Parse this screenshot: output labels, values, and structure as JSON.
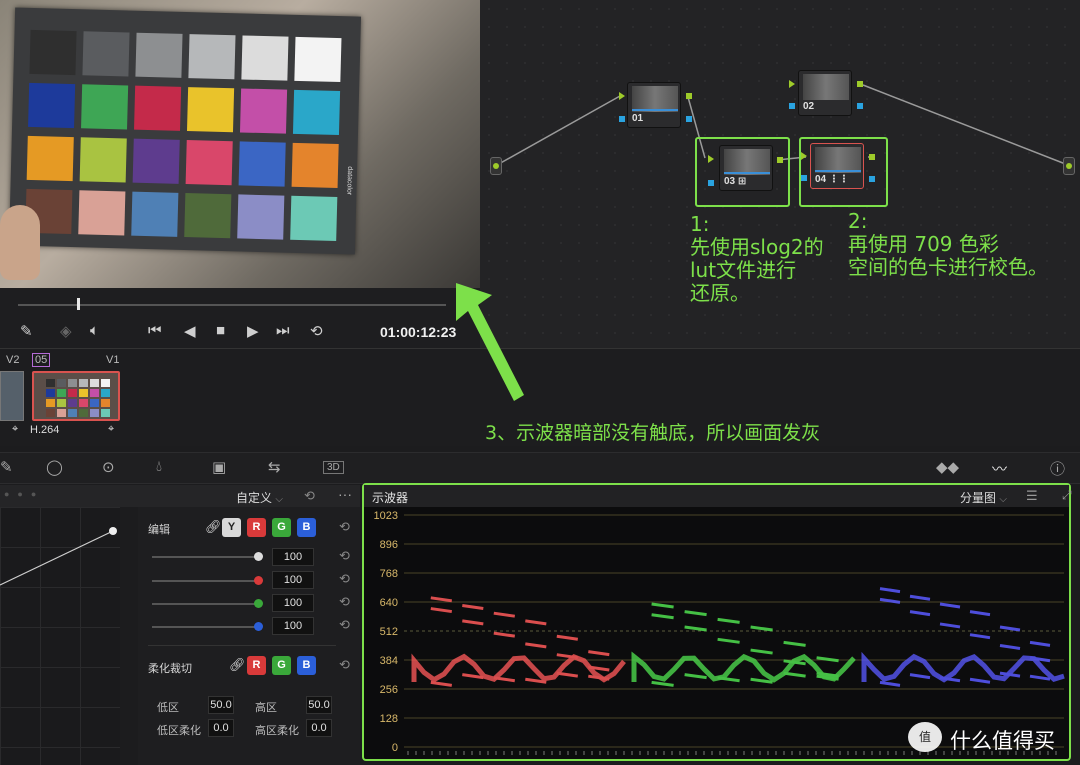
{
  "viewer": {
    "timecode": "01:00:12:23",
    "card_brand": "datacolor",
    "patch_colors": [
      "#2f2f2f",
      "#5a5c5f",
      "#8d8f91",
      "#b6b8ba",
      "#dcdcdc",
      "#f3f3f3",
      "#1d3a9b",
      "#3ea655",
      "#c42a4a",
      "#e9c32b",
      "#c34fa8",
      "#2aa7c9",
      "#e59a24",
      "#a9c341",
      "#5e3c8e",
      "#d9476a",
      "#3b66c4",
      "#e4842c",
      "#6a4236",
      "#d9a196",
      "#4f80b5",
      "#4f6a3a",
      "#8b8dc6",
      "#6cc9b5"
    ]
  },
  "transport": {
    "icons": [
      "eyedropper-icon",
      "layers-icon",
      "volume-icon",
      "skip-start-icon",
      "play-reverse-icon",
      "stop-icon",
      "play-icon",
      "skip-end-icon",
      "loop-icon"
    ]
  },
  "nodes": [
    {
      "id": "01",
      "label": "01"
    },
    {
      "id": "02",
      "label": "02"
    },
    {
      "id": "03",
      "label": "03"
    },
    {
      "id": "04",
      "label": "04"
    }
  ],
  "annotations": {
    "note1": [
      "1:",
      "先使用slog2的",
      "lut文件进行",
      "还原。"
    ],
    "note2": [
      "2:",
      "再使用 709 色彩",
      "空间的色卡进行校色。"
    ],
    "note3": "3、示波器暗部没有触底，所以画面发灰"
  },
  "timeline": {
    "track_v2": "V2",
    "clip_number": "05",
    "track_v1": "V1",
    "codec": "H.264"
  },
  "curves": {
    "mode": "自定义",
    "edit_label": "编辑",
    "channels": [
      "Y",
      "R",
      "G",
      "B"
    ],
    "channel_colors": [
      "#d9d9d9",
      "#d93a3a",
      "#3aa83a",
      "#2b5fd9"
    ],
    "slider_values": [
      "100",
      "100",
      "100",
      "100"
    ],
    "soft_clip_label": "柔化裁切",
    "low_label": "低区",
    "low_value": "50.0",
    "high_label": "高区",
    "high_value": "50.0",
    "low_soft_label": "低区柔化",
    "low_soft_value": "0.0",
    "high_soft_label": "高区柔化",
    "high_soft_value": "0.0"
  },
  "scope": {
    "title": "示波器",
    "mode": "分量图",
    "y_ticks": [
      "1023",
      "896",
      "768",
      "640",
      "512",
      "384",
      "256",
      "128",
      "0"
    ]
  },
  "watermark": {
    "text": "什么值得买",
    "logo": "值"
  }
}
